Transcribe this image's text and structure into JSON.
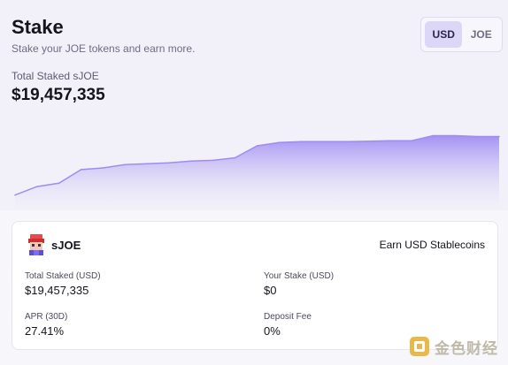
{
  "header": {
    "title": "Stake",
    "subtitle": "Stake your JOE tokens and earn more.",
    "currency_toggle": {
      "options": [
        "USD",
        "JOE"
      ],
      "selected": "USD"
    }
  },
  "summary": {
    "total_label": "Total Staked sJOE",
    "total_value": "$19,457,335"
  },
  "chart_data": {
    "type": "area",
    "title": "",
    "xlabel": "",
    "ylabel": "",
    "grid": false,
    "legend": "none",
    "color": "#9f8cf2",
    "series": [
      {
        "values": [
          69,
          74,
          76,
          84,
          85,
          87,
          87.5,
          88,
          89,
          89.5,
          91,
          98,
          100,
          100.5,
          100.5,
          100.5,
          100.7,
          101,
          101,
          104,
          104,
          103.5,
          103.5
        ]
      }
    ],
    "ylim": [
      60,
      110
    ]
  },
  "pool": {
    "token_name": "sJOE",
    "earn_label": "Earn USD Stablecoins",
    "stats": {
      "total_staked_label": "Total Staked (USD)",
      "total_staked_value": "$19,457,335",
      "your_stake_label": "Your Stake (USD)",
      "your_stake_value": "$0",
      "apr_label": "APR (30D)",
      "apr_value": "27.41%",
      "deposit_fee_label": "Deposit Fee",
      "deposit_fee_value": "0%"
    }
  },
  "watermark": {
    "text": "金色财经"
  },
  "colors": {
    "accent": "#9f8cf2",
    "toggle_active_bg": "#dcd7f7",
    "background": "#f2f1f9"
  }
}
